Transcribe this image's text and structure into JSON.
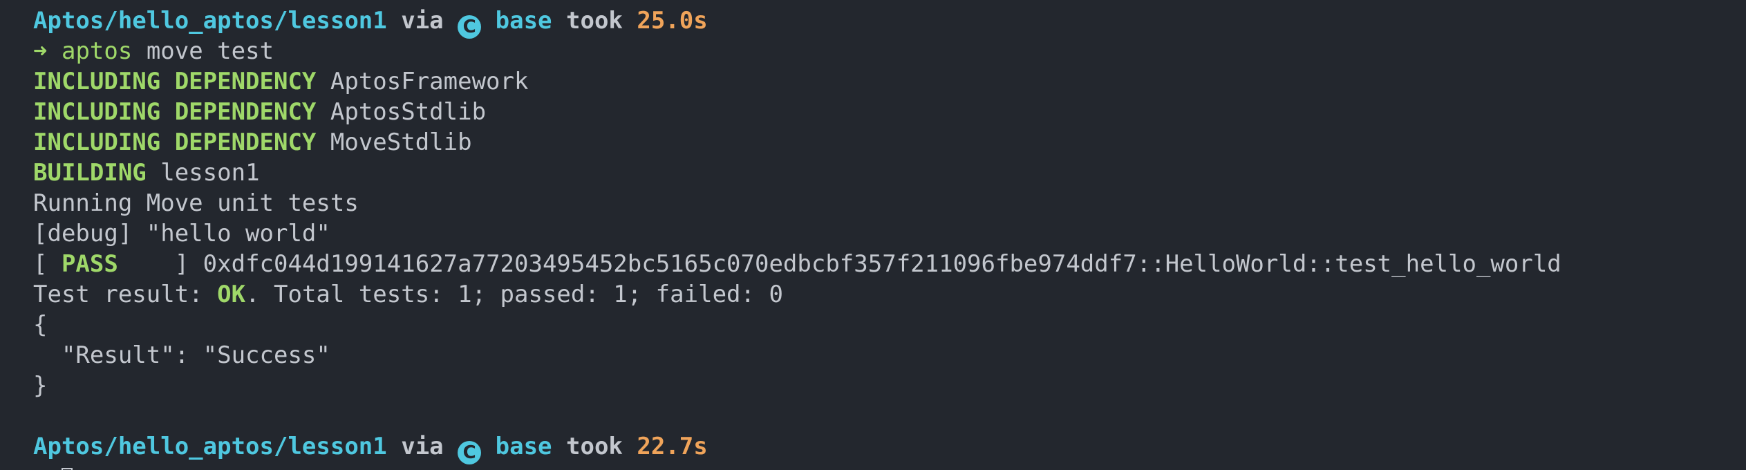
{
  "colors": {
    "background": "#23272e",
    "path": "#4fc8e0",
    "duration": "#f0a45a",
    "keyword": "#9fd869",
    "text": "#c3c7ce"
  },
  "prompt1": {
    "path": "Aptos/hello_aptos/lesson1",
    "via": "via",
    "env_icon": "conda-c-icon",
    "env_icon_glyph": "C",
    "env": "base",
    "took": "took",
    "duration": "25.0s"
  },
  "command": {
    "arrow": "➜",
    "program": "aptos",
    "args": "move test"
  },
  "output": {
    "deps": [
      {
        "label": "INCLUDING DEPENDENCY",
        "name": "AptosFramework"
      },
      {
        "label": "INCLUDING DEPENDENCY",
        "name": "AptosStdlib"
      },
      {
        "label": "INCLUDING DEPENDENCY",
        "name": "MoveStdlib"
      }
    ],
    "building": {
      "label": "BUILDING",
      "name": "lesson1"
    },
    "running": "Running Move unit tests",
    "debug": "[debug] \"hello world\"",
    "pass": {
      "open": "[ ",
      "label": "PASS",
      "close": "    ] ",
      "test": "0xdfc044d199141627a77203495452bc5165c070edbcbf357f211096fbe974ddf7::HelloWorld::test_hello_world"
    },
    "result": {
      "prefix": "Test result: ",
      "status": "OK",
      "suffix": ". Total tests: 1; passed: 1; failed: 0"
    },
    "json_open": "{",
    "json_body": "  \"Result\": \"Success\"",
    "json_close": "}"
  },
  "prompt2": {
    "path": "Aptos/hello_aptos/lesson1",
    "via": "via",
    "env_icon": "conda-c-icon",
    "env_icon_glyph": "C",
    "env": "base",
    "took": "took",
    "duration": "22.7s"
  }
}
